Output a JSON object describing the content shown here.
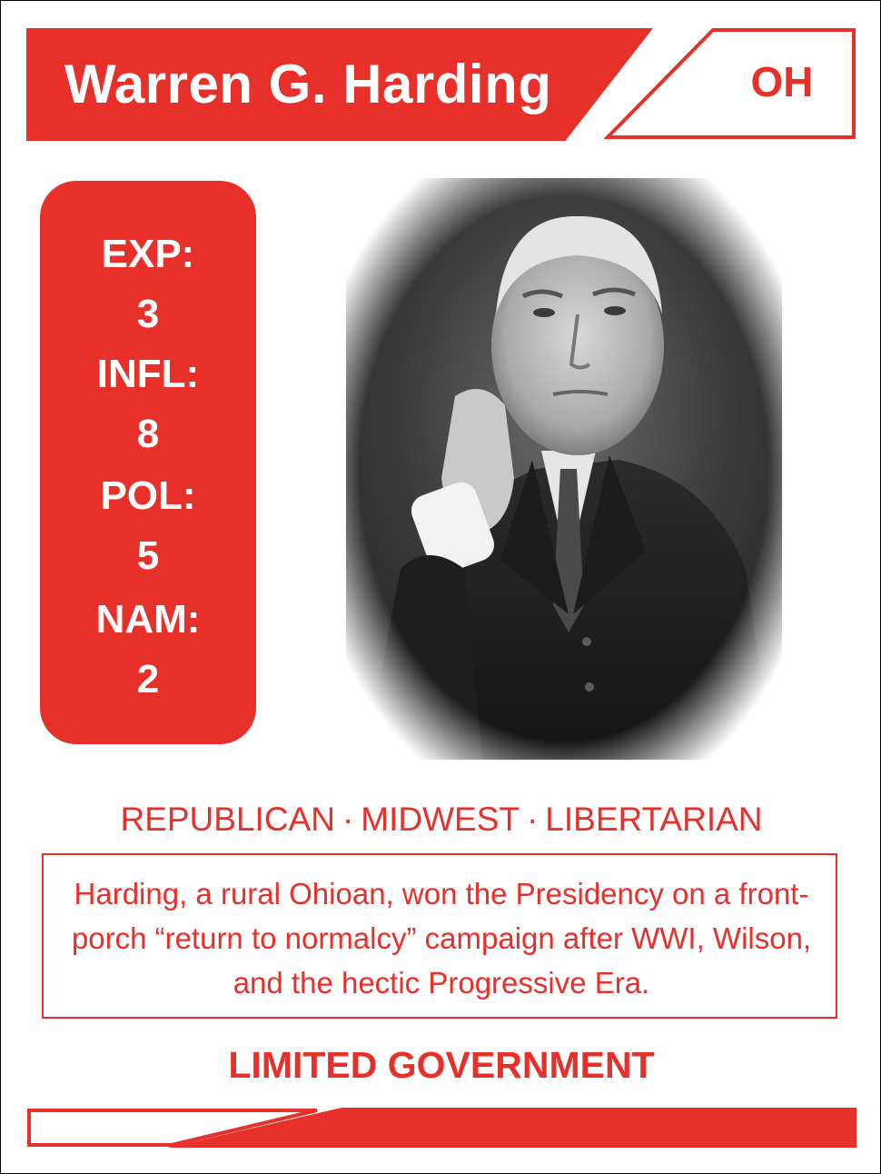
{
  "card": {
    "name": "Warren G. Harding",
    "state": "OH",
    "stats": [
      "EXP:",
      "3",
      "INFL:",
      "8",
      "POL:",
      "5",
      "NAM:",
      "2"
    ],
    "tags": [
      "REPUBLICAN",
      "MIDWEST",
      "LIBERTARIAN"
    ],
    "tag_separator": "·",
    "description": "Harding, a rural Ohioan, won the Presidency on a front-porch “return to normalcy” campaign after WWI, Wilson, and the hectic Progressive Era.",
    "ideology": "LIMITED GOVERNMENT",
    "portrait_icon": "portrait-photo",
    "accent_color": "#e8302a"
  }
}
